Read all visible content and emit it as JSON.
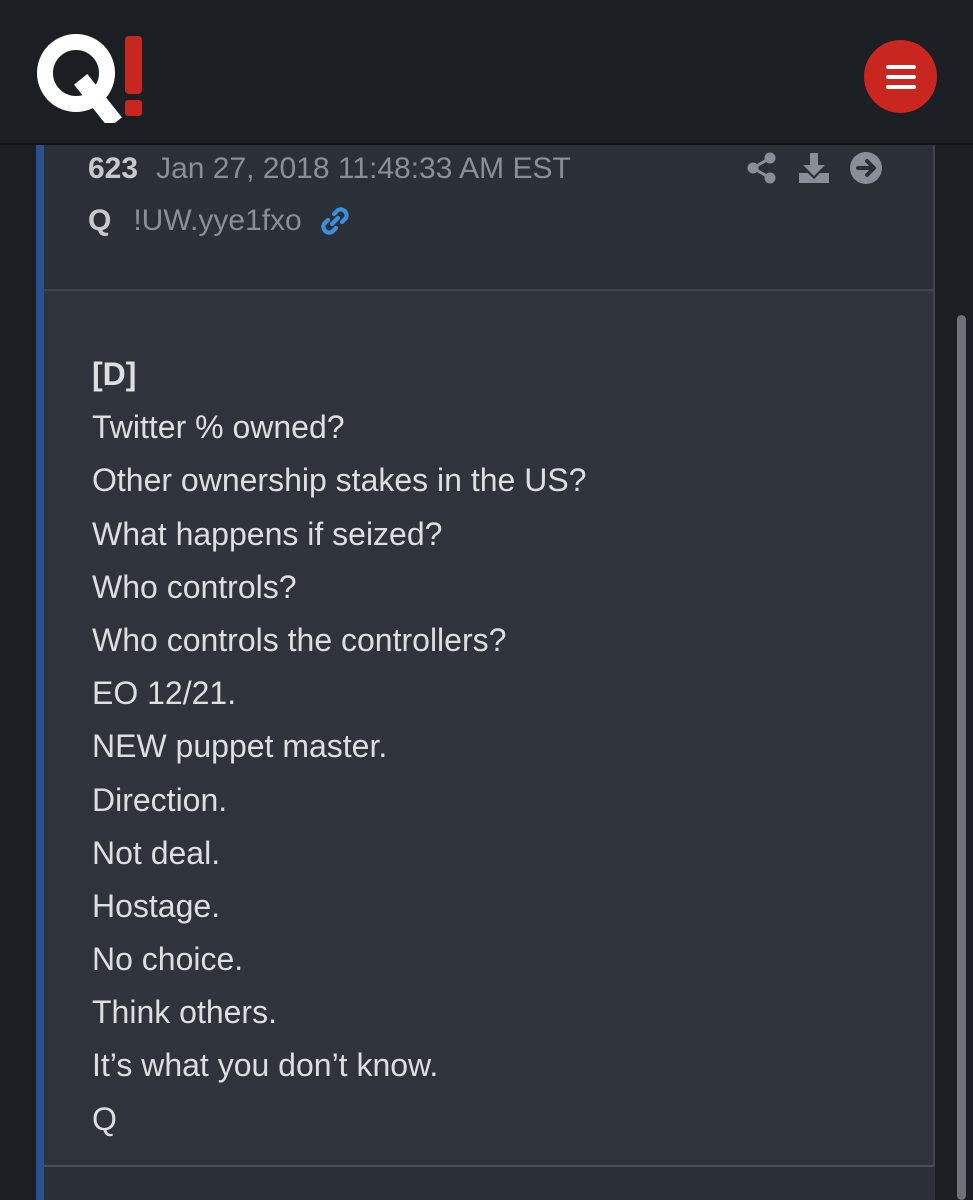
{
  "header": {
    "logo_text": "Q!",
    "logo_colors": {
      "q": "#ffffff",
      "bang": "#c9261f"
    },
    "menu_icon": "hamburger-icon",
    "menu_color": "#c9261f"
  },
  "post": {
    "number": "623",
    "date": "Jan 27, 2018 11:48:33 AM EST",
    "author": "Q",
    "tripcode": "!UW.yye1fxo",
    "icons": [
      "link-icon",
      "share-icon",
      "download-icon",
      "arrow-right-circle-icon"
    ],
    "accent_color": "#2a4f8f",
    "lines": [
      "[D]",
      "Twitter % owned?",
      "Other ownership stakes in the US?",
      "What happens if seized?",
      "Who controls?",
      "Who controls the controllers?",
      "EO 12/21.",
      "NEW puppet master.",
      "Direction.",
      "Not deal.",
      "Hostage.",
      "No choice.",
      "Think others.",
      "It’s what you don’t know.",
      "Q"
    ]
  }
}
